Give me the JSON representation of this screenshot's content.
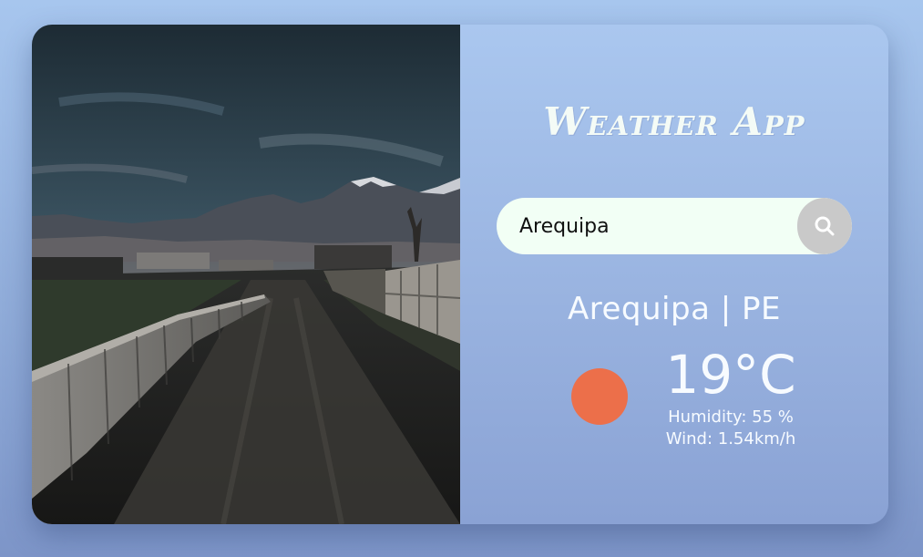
{
  "app": {
    "title": "Weather App"
  },
  "search": {
    "value": "Arequipa",
    "icon": "search-icon"
  },
  "weather": {
    "location": "Arequipa | PE",
    "temperature": "19°C",
    "humidity": "Humidity: 55 %",
    "wind": "Wind: 1.54km/h",
    "icon": "sun-icon"
  },
  "colors": {
    "sun": "#ec6f4a",
    "search_bg": "#f2fff5",
    "search_button": "#c9c9c9"
  },
  "photo": {
    "subject": "mountain-road-photo"
  }
}
